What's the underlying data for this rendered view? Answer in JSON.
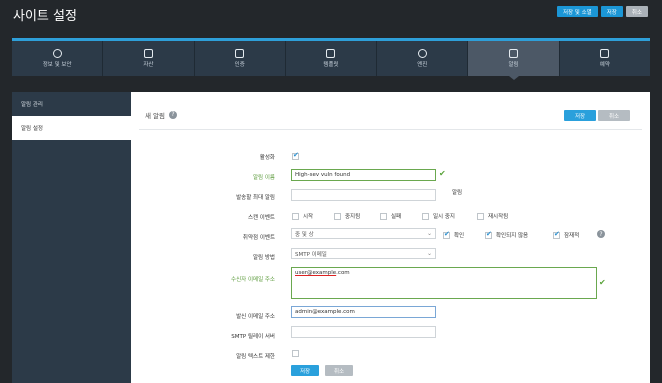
{
  "app": {
    "title": "사이트 설정"
  },
  "top_actions": {
    "save_publish": "저장 및 소멸",
    "save": "저장",
    "cancel": "취소"
  },
  "nav": [
    {
      "label": "정보 및 보안",
      "icon": "info-icon"
    },
    {
      "label": "자산",
      "icon": "assets-icon"
    },
    {
      "label": "인증",
      "icon": "authentication-icon"
    },
    {
      "label": "템플릿",
      "icon": "template-icon"
    },
    {
      "label": "엔진",
      "icon": "engine-icon"
    },
    {
      "label": "알림",
      "icon": "shield-check-icon"
    },
    {
      "label": "예약",
      "icon": "calendar-icon"
    }
  ],
  "sidebar": {
    "items": [
      {
        "label": "알림 관리"
      },
      {
        "label": "알림 설정"
      }
    ]
  },
  "panel": {
    "title": "새 알림",
    "save": "저장",
    "cancel": "취소"
  },
  "form": {
    "enabled_label": "활성화",
    "name_label": "알림 이름",
    "name_value": "High-sev vuln found",
    "max_alerts_label": "발송할 최대 알림",
    "max_alerts_unit": "알림",
    "scan_events_label": "스캔 이벤트",
    "scan_events": [
      "시작",
      "중지됨",
      "실패",
      "일시 중지",
      "재시작됨"
    ],
    "vuln_events_label": "취약점 이벤트",
    "vuln_select": "중 및 상",
    "vuln_events": [
      "확인",
      "확인되지 않음",
      "잠재적"
    ],
    "method_label": "알림 방법",
    "method_value": "SMTP 이메일",
    "recipient_label": "수신자 이메일 주소",
    "recipient_user": "user@example",
    "recipient_domain": ".com",
    "sender_label": "발신 이메일 주소",
    "sender_value": "admin@example.com",
    "relay_label": "SMTP 릴레이 서버",
    "limit_text_label": "알림 텍스트 제한",
    "save": "저장",
    "cancel": "취소"
  },
  "colors": {
    "accent": "#1b96d6",
    "nav_bg": "#2c3a48",
    "valid": "#5aa33a"
  }
}
